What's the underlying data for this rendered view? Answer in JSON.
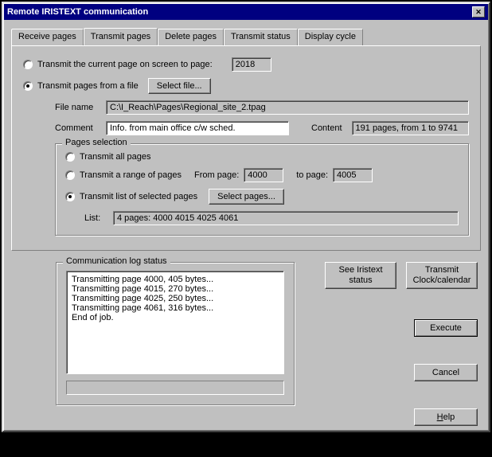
{
  "window": {
    "title": "Remote IRISTEXT communication"
  },
  "tabs": {
    "receive": "Receive pages",
    "transmit": "Transmit pages",
    "delete": "Delete pages",
    "status": "Transmit status",
    "display": "Display cycle"
  },
  "opt_current": {
    "label": "Transmit the current page on screen to page:",
    "value": "2018"
  },
  "opt_file": {
    "label": "Transmit pages from a file",
    "select_file_btn": "Select file..."
  },
  "file": {
    "name_label": "File name",
    "name_value": "C:\\I_Reach\\Pages\\Regional_site_2.tpag",
    "comment_label": "Comment",
    "comment_value": "Info. from main office c/w sched.",
    "content_label": "Content",
    "content_value": "191 pages, from 1 to 9741"
  },
  "pages": {
    "legend": "Pages selection",
    "all_label": "Transmit all pages",
    "range_label": "Transmit a range of pages",
    "from_label": "From page:",
    "from_value": "4000",
    "to_label": "to page:",
    "to_value": "4005",
    "list_opt_label": "Transmit list of selected pages",
    "select_pages_btn": "Select pages...",
    "list_label": "List:",
    "list_value": "4 pages: 4000 4015 4025 4061"
  },
  "log": {
    "legend": "Communication log status",
    "lines": [
      "Transmitting page 4000, 405 bytes...",
      "Transmitting page 4015, 270 bytes...",
      "Transmitting page 4025, 250 bytes...",
      "Transmitting page 4061, 316 bytes...",
      "End of job."
    ]
  },
  "buttons": {
    "see_status": "See Iristext status",
    "transmit_clock": "Transmit Clock/calendar",
    "execute": "Execute",
    "cancel": "Cancel",
    "help": "Help"
  }
}
